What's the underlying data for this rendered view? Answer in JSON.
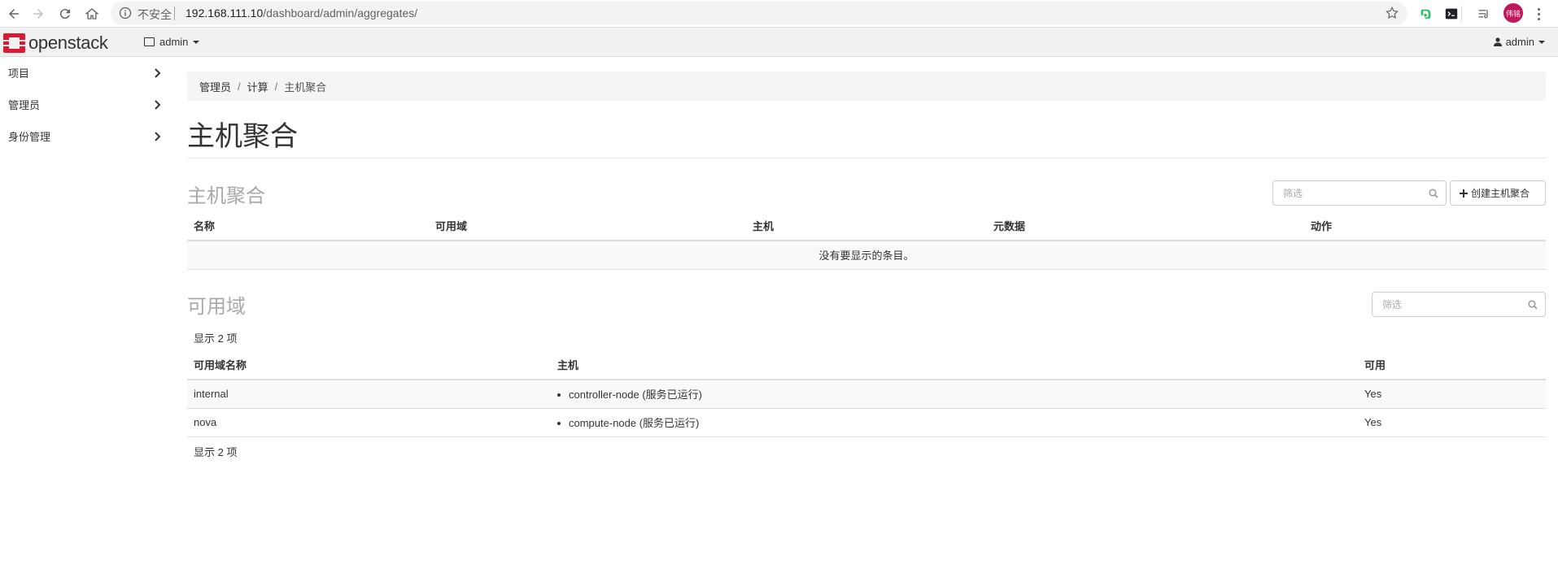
{
  "browser": {
    "insecure_label": "不安全",
    "url_host": "192.168.111.10",
    "url_path": "/dashboard/admin/aggregates/",
    "profile_initials": "伟铭"
  },
  "topnav": {
    "brand": "openstack",
    "project": "admin",
    "user": "admin"
  },
  "sidebar": {
    "items": [
      {
        "label": "项目"
      },
      {
        "label": "管理员"
      },
      {
        "label": "身份管理"
      }
    ]
  },
  "breadcrumb": {
    "items": [
      "管理员",
      "计算",
      "主机聚合"
    ]
  },
  "page_title": "主机聚合",
  "aggregates": {
    "title": "主机聚合",
    "filter_placeholder": "筛选",
    "create_label": "创建主机聚合",
    "columns": [
      "名称",
      "可用域",
      "主机",
      "元数据",
      "动作"
    ],
    "empty_message": "没有要显示的条目。"
  },
  "zones": {
    "title": "可用域",
    "filter_placeholder": "筛选",
    "count_label": "显示 2 项",
    "columns": [
      "可用域名称",
      "主机",
      "可用"
    ],
    "rows": [
      {
        "name": "internal",
        "host": "controller-node (服务已运行)",
        "available": "Yes"
      },
      {
        "name": "nova",
        "host": "compute-node (服务已运行)",
        "available": "Yes"
      }
    ]
  },
  "colors": {
    "brand_red": "#da1a32",
    "avatar": "#c2185b",
    "evernote_green": "#2dbe60"
  }
}
